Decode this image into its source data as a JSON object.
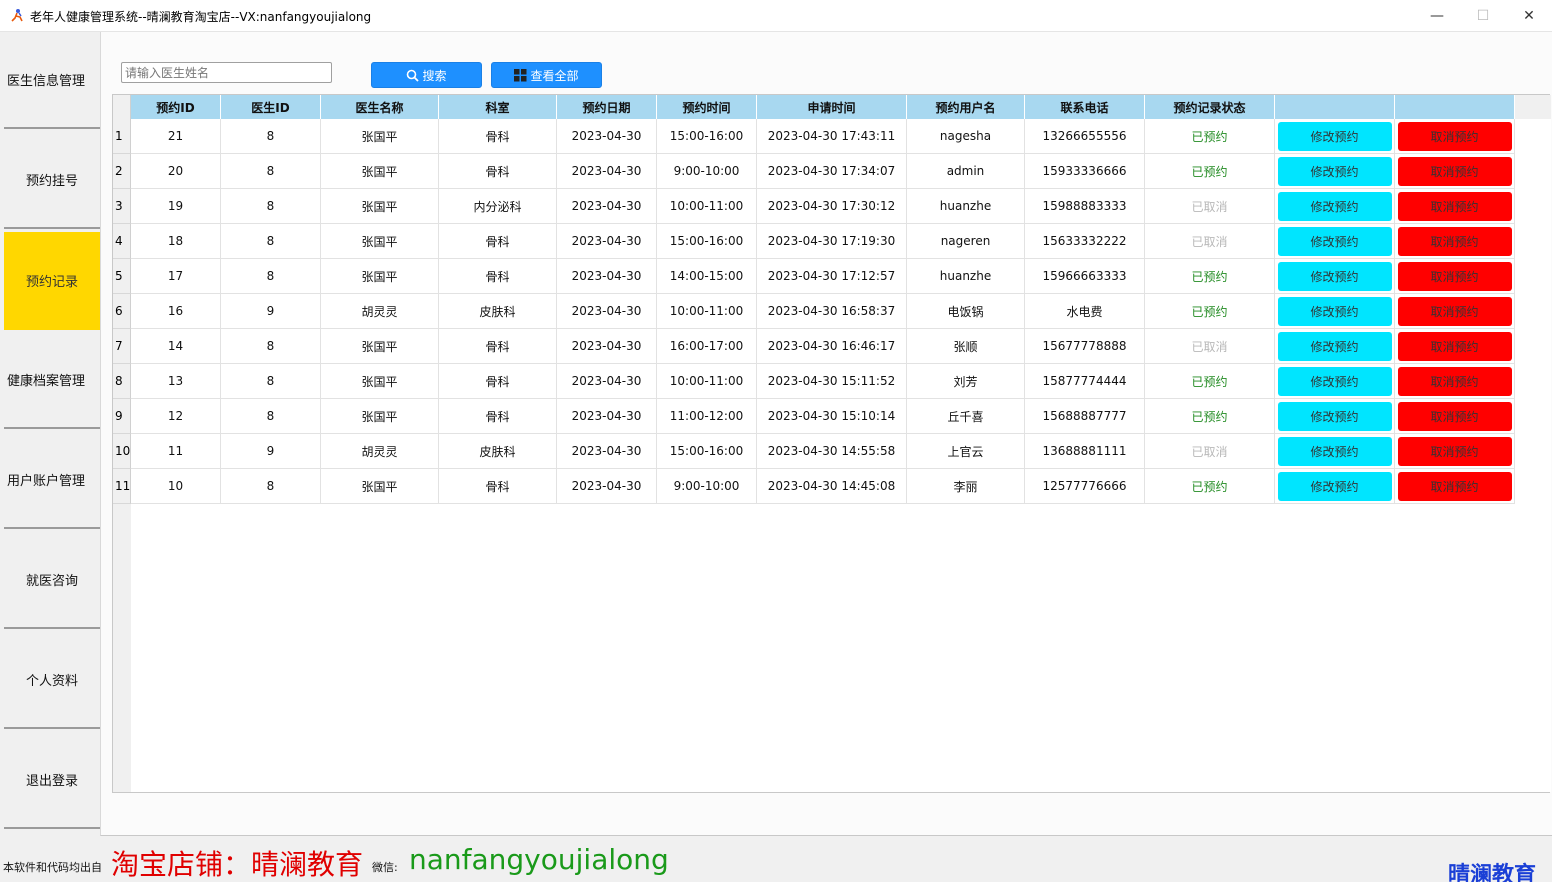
{
  "window": {
    "title": "老年人健康管理系统--晴澜教育淘宝店--VX:nanfangyoujialong",
    "minimize": "—",
    "maximize": "☐",
    "close": "✕"
  },
  "sidebar": {
    "active_index": 2,
    "items": [
      {
        "label": "医生信息管理"
      },
      {
        "label": "预约挂号"
      },
      {
        "label": "预约记录"
      },
      {
        "label": "健康档案管理"
      },
      {
        "label": "用户账户管理"
      },
      {
        "label": "就医咨询"
      },
      {
        "label": "个人资料"
      },
      {
        "label": "退出登录"
      }
    ]
  },
  "toolbar": {
    "search_placeholder": "请输入医生姓名",
    "search_value": "",
    "search_label": "搜索",
    "view_all_label": "查看全部"
  },
  "table": {
    "columns": [
      "预约ID",
      "医生ID",
      "医生名称",
      "科室",
      "预约日期",
      "预约时间",
      "申请时间",
      "预约用户名",
      "联系电话",
      "预约记录状态",
      "",
      ""
    ],
    "modify_label": "修改预约",
    "cancel_label": "取消预约",
    "rows": [
      {
        "num": "1",
        "cells": [
          "21",
          "8",
          "张国平",
          "骨科",
          "2023-04-30",
          "15:00-16:00",
          "2023-04-30 17:43:11",
          "nagesha",
          "13266655556",
          "已预约"
        ],
        "status": "booked"
      },
      {
        "num": "2",
        "cells": [
          "20",
          "8",
          "张国平",
          "骨科",
          "2023-04-30",
          "9:00-10:00",
          "2023-04-30 17:34:07",
          "admin",
          "15933336666",
          "已预约"
        ],
        "status": "booked"
      },
      {
        "num": "3",
        "cells": [
          "19",
          "8",
          "张国平",
          "内分泌科",
          "2023-04-30",
          "10:00-11:00",
          "2023-04-30 17:30:12",
          "huanzhe",
          "15988883333",
          "已取消"
        ],
        "status": "cancelled"
      },
      {
        "num": "4",
        "cells": [
          "18",
          "8",
          "张国平",
          "骨科",
          "2023-04-30",
          "15:00-16:00",
          "2023-04-30 17:19:30",
          "nageren",
          "15633332222",
          "已取消"
        ],
        "status": "cancelled"
      },
      {
        "num": "5",
        "cells": [
          "17",
          "8",
          "张国平",
          "骨科",
          "2023-04-30",
          "14:00-15:00",
          "2023-04-30 17:12:57",
          "huanzhe",
          "15966663333",
          "已预约"
        ],
        "status": "booked"
      },
      {
        "num": "6",
        "cells": [
          "16",
          "9",
          "胡灵灵",
          "皮肤科",
          "2023-04-30",
          "10:00-11:00",
          "2023-04-30 16:58:37",
          "电饭锅",
          "水电费",
          "已预约"
        ],
        "status": "booked"
      },
      {
        "num": "7",
        "cells": [
          "14",
          "8",
          "张国平",
          "骨科",
          "2023-04-30",
          "16:00-17:00",
          "2023-04-30 16:46:17",
          "张顺",
          "15677778888",
          "已取消"
        ],
        "status": "cancelled"
      },
      {
        "num": "8",
        "cells": [
          "13",
          "8",
          "张国平",
          "骨科",
          "2023-04-30",
          "10:00-11:00",
          "2023-04-30 15:11:52",
          "刘芳",
          "15877774444",
          "已预约"
        ],
        "status": "booked"
      },
      {
        "num": "9",
        "cells": [
          "12",
          "8",
          "张国平",
          "骨科",
          "2023-04-30",
          "11:00-12:00",
          "2023-04-30 15:10:14",
          "丘千喜",
          "15688887777",
          "已预约"
        ],
        "status": "booked"
      },
      {
        "num": "10",
        "cells": [
          "11",
          "9",
          "胡灵灵",
          "皮肤科",
          "2023-04-30",
          "15:00-16:00",
          "2023-04-30 14:55:58",
          "上官云",
          "13688881111",
          "已取消"
        ],
        "status": "cancelled"
      },
      {
        "num": "11",
        "cells": [
          "10",
          "8",
          "张国平",
          "骨科",
          "2023-04-30",
          "9:00-10:00",
          "2023-04-30 14:45:08",
          "李丽",
          "12577776666",
          "已预约"
        ],
        "status": "booked"
      }
    ]
  },
  "footer": {
    "prefix": "本软件和代码均出自",
    "shop": "淘宝店铺：晴澜教育",
    "wechat_label": "微信:",
    "wechat_id": "nanfangyoujialong",
    "brand": "晴澜教育"
  },
  "colors": {
    "header_bg": "#a8d8f0",
    "active_nav": "#ffd700",
    "modify_btn": "#00e5ff",
    "cancel_btn": "#ff0000",
    "primary_btn": "#1e90ff",
    "status_booked": "#228b22",
    "status_cancelled": "#b8b8b8"
  }
}
